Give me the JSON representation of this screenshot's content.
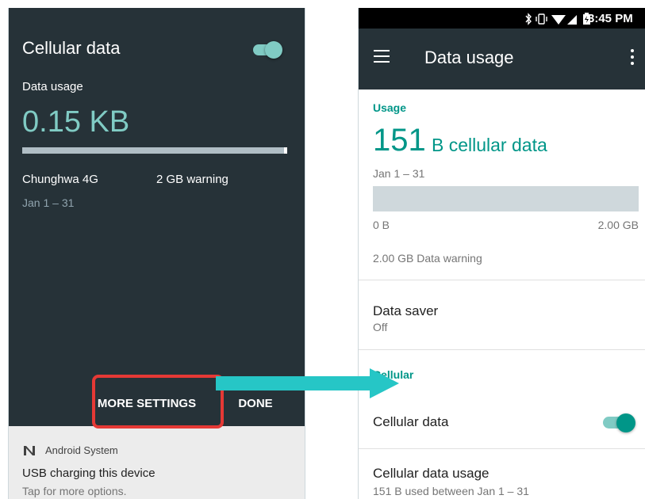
{
  "left_screen": {
    "title": "Cellular data",
    "cellular_toggle_on": true,
    "usage_label": "Data usage",
    "usage_amount": "0.15 KB",
    "carrier": "Chunghwa 4G",
    "warning": "2 GB warning",
    "period": "Jan 1 – 31",
    "more_settings_label": "MORE SETTINGS",
    "done_label": "DONE",
    "notification": {
      "icon": "android-n-icon",
      "app": "Android System",
      "title": "USB charging this device",
      "text": "Tap for more options."
    }
  },
  "right_screen": {
    "status_bar": {
      "icons": [
        "bluetooth-icon",
        "vibrate-icon",
        "wifi-icon",
        "signal-icon",
        "battery-icon"
      ],
      "time": "3:45 PM"
    },
    "app_bar": {
      "menu_icon": "hamburger-menu-icon",
      "title": "Data usage",
      "overflow_icon": "more-vert-icon"
    },
    "usage_section": {
      "header": "Usage",
      "amount_number": "151",
      "amount_unit": "B cellular data",
      "period": "Jan 1 – 31",
      "bar_min_label": "0 B",
      "bar_max_label": "2.00 GB",
      "warning": "2.00 GB Data warning"
    },
    "data_saver": {
      "label": "Data saver",
      "value": "Off"
    },
    "cellular_section": {
      "header": "Cellular",
      "cellular_data_label": "Cellular data",
      "cellular_data_on": true,
      "cellular_usage_label": "Cellular data usage",
      "cellular_usage_sub": "151 B used between Jan 1 – 31"
    }
  },
  "annotation": {
    "highlight_color": "#e53935",
    "arrow_color": "#26c6c6",
    "arrow_from": "MORE SETTINGS",
    "arrow_to": "Data usage"
  },
  "colors": {
    "dark_surface": "#263238",
    "accent_teal": "#009688",
    "light_teal": "#80cbc4"
  }
}
